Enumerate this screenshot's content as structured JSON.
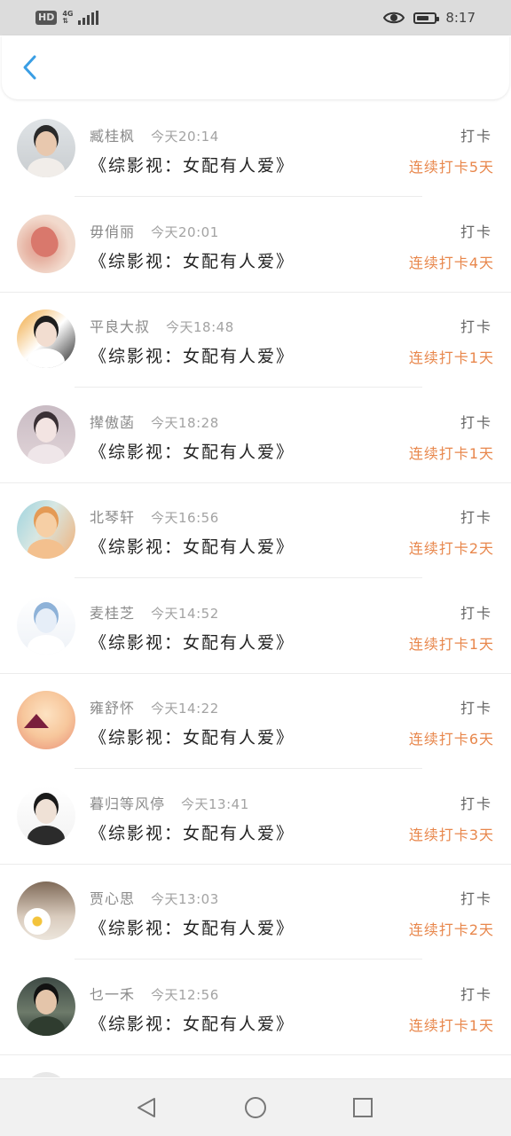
{
  "status_bar": {
    "hd_label": "HD",
    "network_label": "4G",
    "time": "8:17",
    "battery_level": 0.7,
    "icons": [
      "hd-icon",
      "signal-icon",
      "eye-icon",
      "battery-icon"
    ]
  },
  "header": {
    "back_icon": "chevron-left-icon",
    "accent_color": "#3a9ee4"
  },
  "colors": {
    "streak_text": "#e8874c",
    "divider": "#ececec"
  },
  "entries": [
    {
      "name": "臧桂枫",
      "time": "今天20:14",
      "book": "《综影视：女配有人爱》",
      "checkin": "打卡",
      "streak": "连续打卡5天",
      "avatar_desc": "man in white shirt"
    },
    {
      "name": "毋俏丽",
      "time": "今天20:01",
      "book": "《综影视：女配有人爱》",
      "checkin": "打卡",
      "streak": "连续打卡4天",
      "avatar_desc": "flower"
    },
    {
      "name": "平良大叔",
      "time": "今天18:48",
      "book": "《综影视：女配有人爱》",
      "checkin": "打卡",
      "streak": "连续打卡1天",
      "avatar_desc": "girl portrait"
    },
    {
      "name": "撵傲菡",
      "time": "今天18:28",
      "book": "《综影视：女配有人爱》",
      "checkin": "打卡",
      "streak": "连续打卡1天",
      "avatar_desc": "ancient style girl"
    },
    {
      "name": "北琴轩",
      "time": "今天16:56",
      "book": "《综影视：女配有人爱》",
      "checkin": "打卡",
      "streak": "连续打卡2天",
      "avatar_desc": "girl at beach"
    },
    {
      "name": "麦桂芝",
      "time": "今天14:52",
      "book": "《综影视：女配有人爱》",
      "checkin": "打卡",
      "streak": "连续打卡1天",
      "avatar_desc": "anime character"
    },
    {
      "name": "雍舒怀",
      "time": "今天14:22",
      "book": "《综影视：女配有人爱》",
      "checkin": "打卡",
      "streak": "连续打卡6天",
      "avatar_desc": "paper cranes"
    },
    {
      "name": "暮归等风停",
      "time": "今天13:41",
      "book": "《综影视：女配有人爱》",
      "checkin": "打卡",
      "streak": "连续打卡3天",
      "avatar_desc": "boy sketch"
    },
    {
      "name": "贾心思",
      "time": "今天13:03",
      "book": "《综影视：女配有人爱》",
      "checkin": "打卡",
      "streak": "连续打卡2天",
      "avatar_desc": "daisy flowers"
    },
    {
      "name": "乜一禾",
      "time": "今天12:56",
      "book": "《综影视：女配有人爱》",
      "checkin": "打卡",
      "streak": "连续打卡1天",
      "avatar_desc": "man holding plant"
    }
  ],
  "nav_bar": {
    "icons": [
      "back-triangle-icon",
      "home-circle-icon",
      "recents-square-icon"
    ]
  }
}
